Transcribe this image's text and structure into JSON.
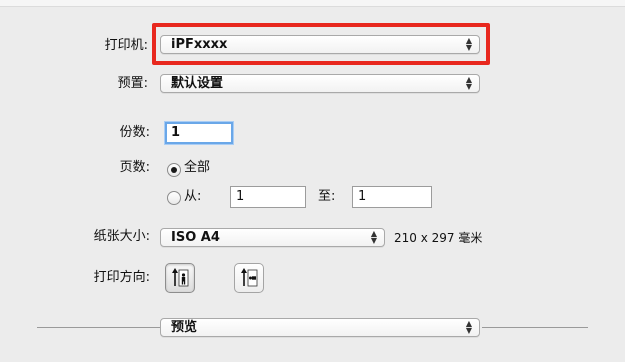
{
  "printer": {
    "label": "打印机:",
    "value": "iPFxxxx"
  },
  "presets": {
    "label": "预置:",
    "value": "默认设置"
  },
  "copies": {
    "label": "份数:",
    "value": "1"
  },
  "pages": {
    "label": "页数:",
    "all_label": "全部",
    "from_label": "从:",
    "from_value": "1",
    "to_label": "至:",
    "to_value": "1"
  },
  "paper_size": {
    "label": "纸张大小:",
    "value": "ISO A4",
    "dimensions": "210 x 297 毫米"
  },
  "orientation": {
    "label": "打印方向:"
  },
  "section_popup": {
    "value": "预览"
  },
  "colors": {
    "highlight": "#e8281e",
    "focus_ring": "#6aa7e8"
  }
}
